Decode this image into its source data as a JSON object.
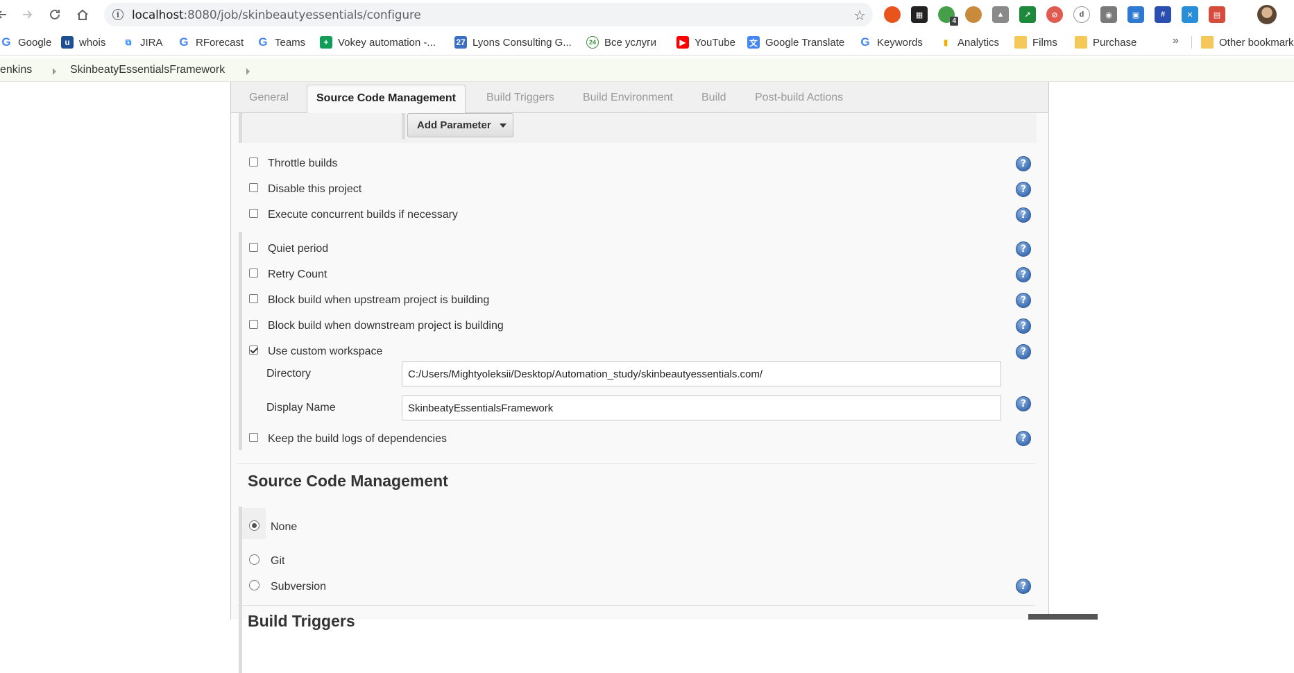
{
  "browser": {
    "url_host": "localhost",
    "url_path": ":8080/job/skinbeautyessentials/configure",
    "extensions": [
      {
        "name": "chrome-color-ext-icon",
        "color": "#e8541c",
        "text": "",
        "round": true
      },
      {
        "name": "qr-code-ext-icon",
        "color": "#222222",
        "text": "▦",
        "round": false
      },
      {
        "name": "green-ext-icon",
        "color": "#46a049",
        "text": "",
        "round": true,
        "badge": "4"
      },
      {
        "name": "cookie-ext-icon",
        "color": "#c98a3b",
        "text": "",
        "round": true
      },
      {
        "name": "drive-ext-icon",
        "color": "#8a8a8a",
        "text": "▲",
        "round": false
      },
      {
        "name": "green-square-ext-icon",
        "color": "#1c8a3a",
        "text": "↗",
        "round": false
      },
      {
        "name": "block-ext-icon",
        "color": "#e05a50",
        "text": "⊘",
        "round": true
      },
      {
        "name": "d-ext-icon",
        "color": "#ffffff",
        "text": "d",
        "round": true
      },
      {
        "name": "camera-ext-icon",
        "color": "#7a7a7a",
        "text": "◉",
        "round": false
      },
      {
        "name": "blue-ext-icon",
        "color": "#2f79d2",
        "text": "▣",
        "round": false
      },
      {
        "name": "grid-ext-icon",
        "color": "#2a4fb0",
        "text": "#",
        "round": false
      },
      {
        "name": "tools-ext-icon",
        "color": "#2a8dd8",
        "text": "✕",
        "round": false
      },
      {
        "name": "calendar-ext-icon",
        "color": "#d54b3d",
        "text": "▤",
        "round": false
      }
    ]
  },
  "bookmarks": [
    {
      "label": "Google",
      "fav": "G",
      "type": "g"
    },
    {
      "label": "whois",
      "fav": "u",
      "type": "whois"
    },
    {
      "label": "JIRA",
      "fav": "⧉",
      "type": "jira"
    },
    {
      "label": "RForecast",
      "fav": "G",
      "type": "g"
    },
    {
      "label": "Teams",
      "fav": "G",
      "type": "g"
    },
    {
      "label": "Vokey automation -...",
      "fav": "+",
      "type": "vokey"
    },
    {
      "label": "Lyons Consulting G...",
      "fav": "27",
      "type": "lyons"
    },
    {
      "label": "Все услуги",
      "fav": "24",
      "type": "uslugi"
    },
    {
      "label": "YouTube",
      "fav": "▶",
      "type": "youtube"
    },
    {
      "label": "Google Translate",
      "fav": "文",
      "type": "translate"
    },
    {
      "label": "Keywords",
      "fav": "G",
      "type": "g"
    },
    {
      "label": "Analytics",
      "fav": "▮",
      "type": "analytics"
    },
    {
      "label": "Films",
      "fav": "",
      "type": "folder"
    },
    {
      "label": "Purchase",
      "fav": "",
      "type": "folder"
    }
  ],
  "bookmarks_more": "»",
  "other_bookmarks": "Other bookmarks",
  "breadcrumbs": [
    "Jenkins",
    "SkinbeatyEssentialsFramework"
  ],
  "tabs": [
    "General",
    "Source Code Management",
    "Build Triggers",
    "Build Environment",
    "Build",
    "Post-build Actions"
  ],
  "add_parameter_label": "Add Parameter",
  "options_group1": [
    {
      "label": "Throttle builds",
      "checked": false
    },
    {
      "label": "Disable this project",
      "checked": false
    },
    {
      "label": "Execute concurrent builds if necessary",
      "checked": false
    }
  ],
  "options_group2": [
    {
      "label": "Quiet period",
      "checked": false
    },
    {
      "label": "Retry Count",
      "checked": false
    },
    {
      "label": "Block build when upstream project is building",
      "checked": false
    },
    {
      "label": "Block build when downstream project is building",
      "checked": false
    },
    {
      "label": "Use custom workspace",
      "checked": true
    }
  ],
  "workspace": {
    "directory_label": "Directory",
    "directory_value": "C:/Users/Mightyoleksii/Desktop/Automation_study/skinbeautyessentials.com/",
    "display_name_label": "Display Name",
    "display_name_value": "SkinbeatyEssentialsFramework"
  },
  "keep_logs": {
    "label": "Keep the build logs of dependencies",
    "checked": false
  },
  "scm": {
    "title": "Source Code Management",
    "options": [
      {
        "label": "None",
        "checked": true
      },
      {
        "label": "Git",
        "checked": false
      },
      {
        "label": "Subversion",
        "checked": false
      }
    ]
  },
  "next_section_title": "Build Triggers",
  "help_symbol": "?",
  "colors": {
    "accent_help": "#3e6fb5",
    "breadcrumb_bg": "#f7faf0",
    "tabbar_bg": "#f0f0f0"
  }
}
